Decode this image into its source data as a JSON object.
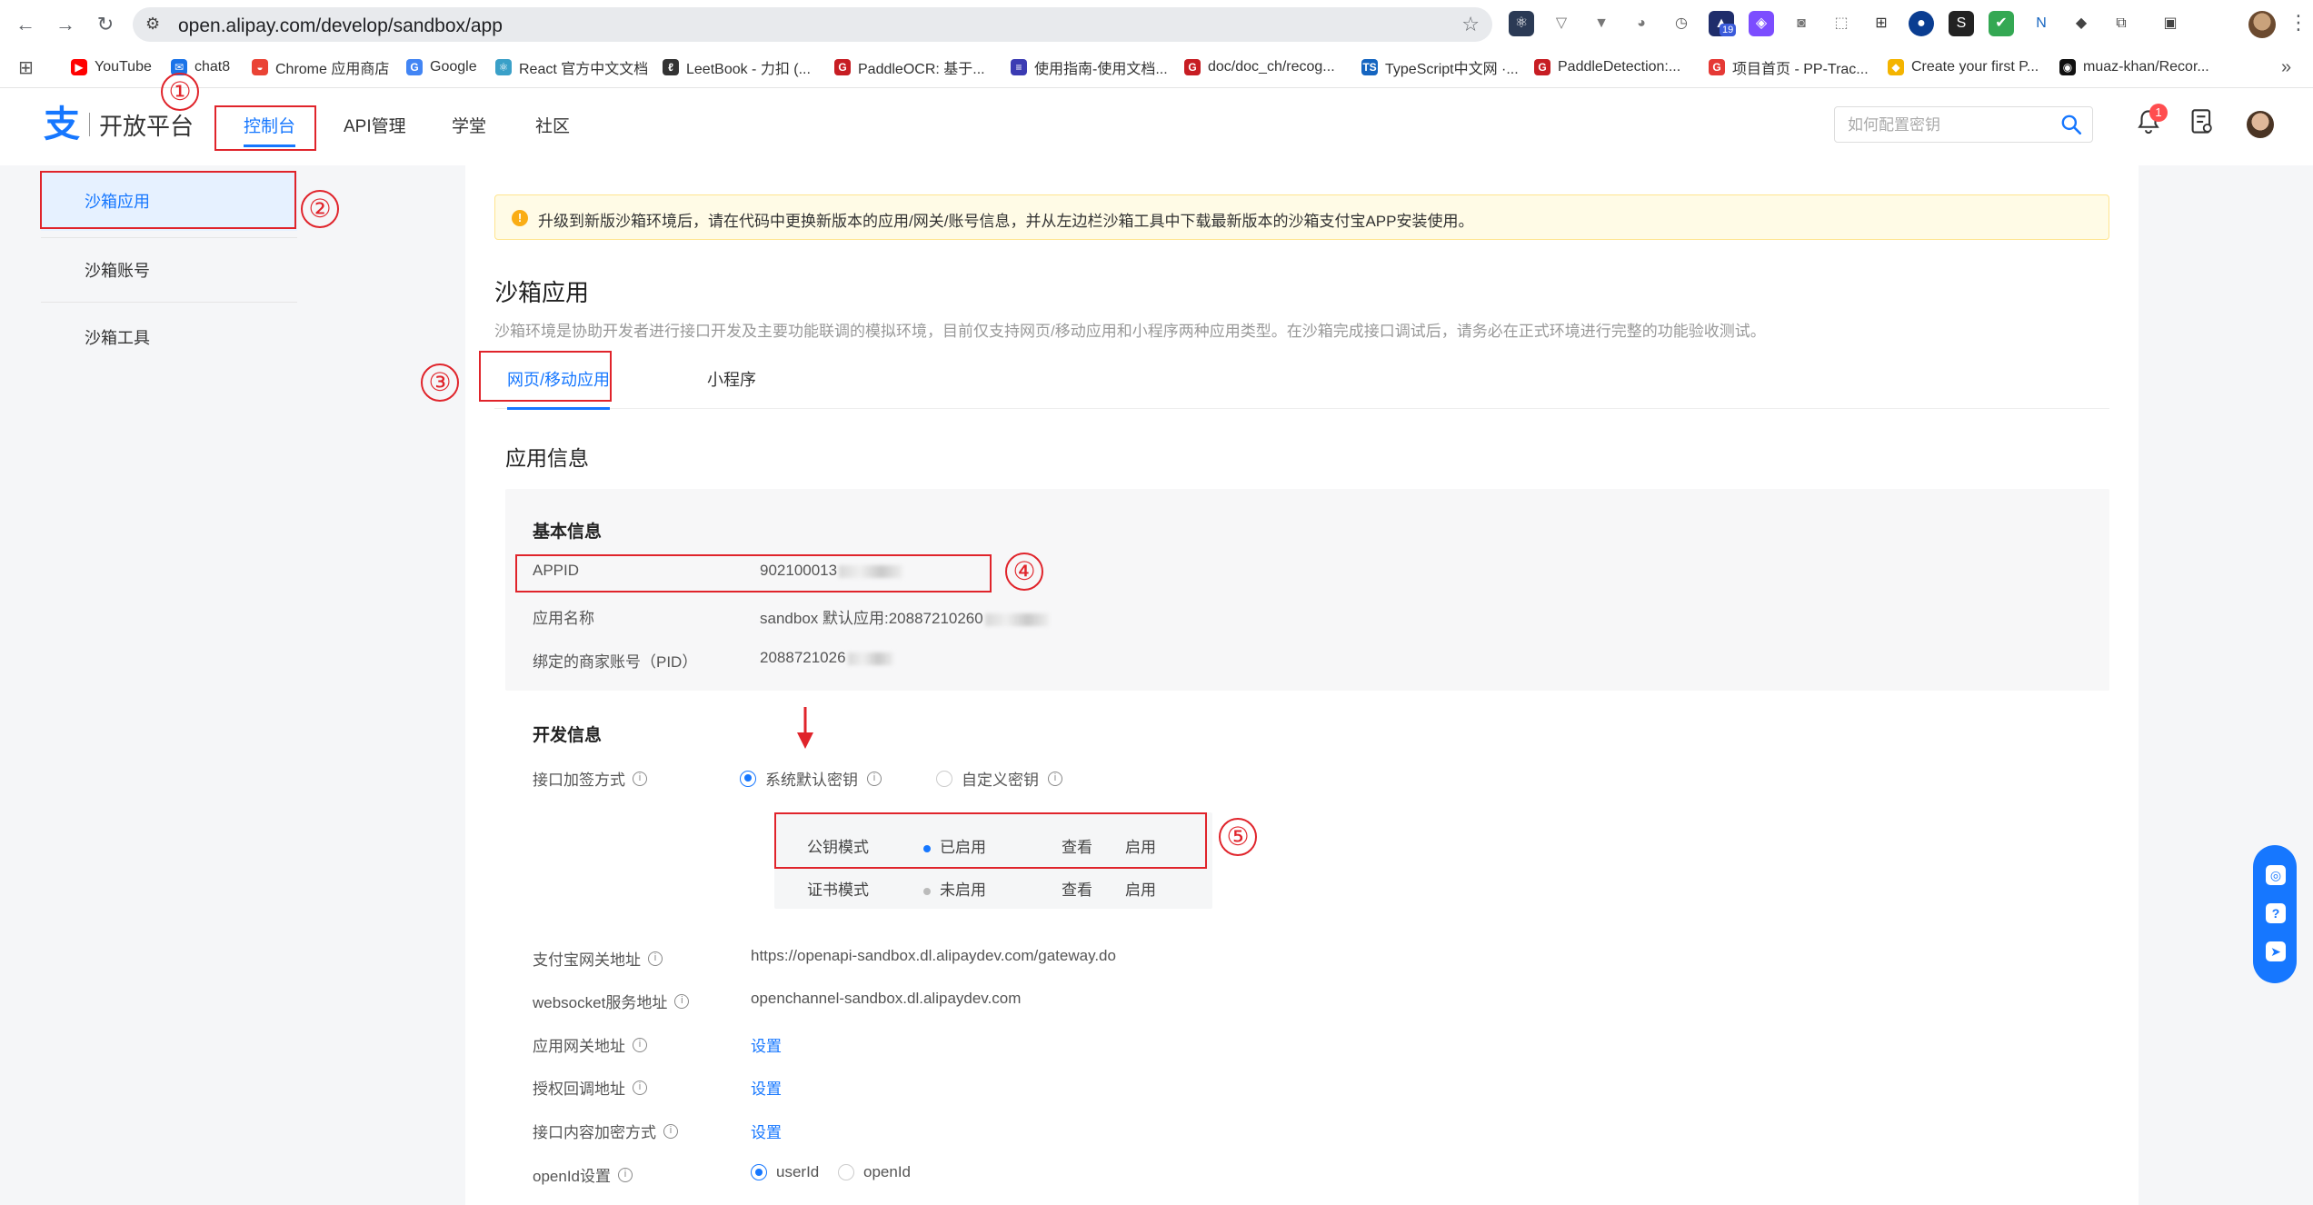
{
  "browser": {
    "url": "open.alipay.com/develop/sandbox/app",
    "bookmarks": [
      {
        "label": "YouTube",
        "icon": "youtube-icon",
        "color": "#ff0000"
      },
      {
        "label": "chat8",
        "icon": "chat-icon",
        "color": "#1a73e8"
      },
      {
        "label": "Chrome 应用商店",
        "icon": "chrome-store-icon",
        "color": "#ea4335"
      },
      {
        "label": "Google",
        "icon": "google-icon",
        "color": "#4285f4"
      },
      {
        "label": "React 官方中文文档",
        "icon": "react-icon",
        "color": "#3aa0c8"
      },
      {
        "label": "LeetBook - 力扣 (...",
        "icon": "leetcode-icon",
        "color": "#333333"
      },
      {
        "label": "PaddleOCR: 基于...",
        "icon": "gitee-icon",
        "color": "#c71d23"
      },
      {
        "label": "使用指南-使用文档...",
        "icon": "doc-icon",
        "color": "#3b3bb3"
      },
      {
        "label": "doc/doc_ch/recog...",
        "icon": "gitee-icon",
        "color": "#c71d23"
      },
      {
        "label": "TypeScript中文网 ·...",
        "icon": "typescript-icon",
        "color": "#1565c0"
      },
      {
        "label": "PaddleDetection:...",
        "icon": "gitee-icon",
        "color": "#c71d23"
      },
      {
        "label": "项目首页 - PP-Trac...",
        "icon": "g-icon",
        "color": "#e53935"
      },
      {
        "label": "Create your first P...",
        "icon": "python-icon",
        "color": "#f4b400"
      },
      {
        "label": "muaz-khan/Recor...",
        "icon": "github-icon",
        "color": "#111111"
      }
    ],
    "extension_badge": "19"
  },
  "header": {
    "logo_mark": "支",
    "logo_text": "开放平台",
    "nav": [
      {
        "label": "控制台",
        "active": true
      },
      {
        "label": "API管理",
        "active": false
      },
      {
        "label": "学堂",
        "active": false
      },
      {
        "label": "社区",
        "active": false
      }
    ],
    "search_placeholder": "如何配置密钥",
    "notification_count": "1"
  },
  "sidebar": {
    "items": [
      {
        "label": "沙箱应用",
        "active": true
      },
      {
        "label": "沙箱账号",
        "active": false
      },
      {
        "label": "沙箱工具",
        "active": false
      }
    ]
  },
  "main": {
    "notice": "升级到新版沙箱环境后，请在代码中更换新版本的应用/网关/账号信息，并从左边栏沙箱工具中下载最新版本的沙箱支付宝APP安装使用。",
    "title": "沙箱应用",
    "description": "沙箱环境是协助开发者进行接口开发及主要功能联调的模拟环境，目前仅支持网页/移动应用和小程序两种应用类型。在沙箱完成接口调试后，请务必在正式环境进行完整的功能验收测试。",
    "tabs": [
      {
        "label": "网页/移动应用",
        "active": true
      },
      {
        "label": "小程序",
        "active": false
      }
    ],
    "app_info_title": "应用信息",
    "basic": {
      "title": "基本信息",
      "rows": [
        {
          "label": "APPID",
          "value": "902100013"
        },
        {
          "label": "应用名称",
          "value": "sandbox 默认应用:20887210260"
        },
        {
          "label": "绑定的商家账号（PID）",
          "value": "2088721026"
        }
      ]
    },
    "dev": {
      "title": "开发信息",
      "sign_label": "接口加签方式",
      "sign_options": [
        {
          "label": "系统默认密钥",
          "checked": true
        },
        {
          "label": "自定义密钥",
          "checked": false
        }
      ],
      "key_modes": [
        {
          "mode": "公钥模式",
          "status": "已启用",
          "status_color": "#1677ff",
          "view": "查看",
          "enable": "启用"
        },
        {
          "mode": "证书模式",
          "status": "未启用",
          "status_color": "#bbbbbb",
          "view": "查看",
          "enable": "启用"
        }
      ],
      "rows": [
        {
          "label": "支付宝网关地址",
          "value": "https://openapi-sandbox.dl.alipaydev.com/gateway.do"
        },
        {
          "label": "websocket服务地址",
          "value": "openchannel-sandbox.dl.alipaydev.com"
        },
        {
          "label": "应用网关地址",
          "value": "设置"
        },
        {
          "label": "授权回调地址",
          "value": "设置"
        },
        {
          "label": "接口内容加密方式",
          "value": "设置"
        }
      ],
      "openid_label": "openId设置",
      "openid_options": [
        {
          "label": "userId",
          "checked": true
        },
        {
          "label": "openId",
          "checked": false
        }
      ]
    }
  },
  "annotations": [
    "①",
    "②",
    "③",
    "④",
    "⑤"
  ],
  "colors": {
    "accent": "#1677ff",
    "annotation": "#e0242b",
    "notice_bg": "#fffbe6"
  }
}
